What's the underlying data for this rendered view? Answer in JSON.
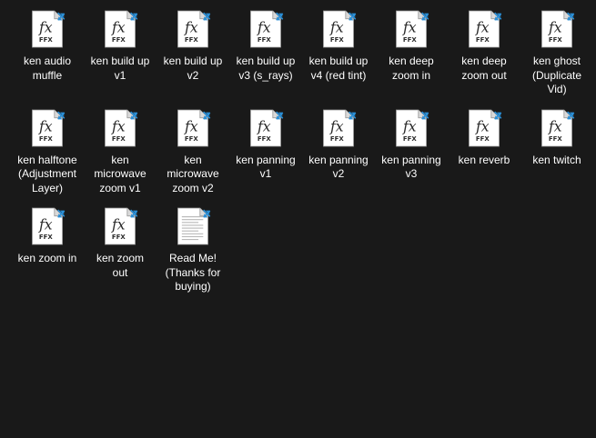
{
  "colors": {
    "background": "#191919",
    "label_text": "#ffffff",
    "page_fill": "#ffffff",
    "page_fold": "#d9d9d9",
    "page_outline": "#9a9a9a",
    "arrow_blue": "#2b8fd6",
    "fx_text": "#2a2a2a"
  },
  "icon_text": {
    "fx": "fx",
    "ffx": "FFX"
  },
  "files": [
    {
      "label": "ken audio muffle",
      "icon": "ffx-file-icon"
    },
    {
      "label": "ken build up v1",
      "icon": "ffx-file-icon"
    },
    {
      "label": "ken build up v2",
      "icon": "ffx-file-icon"
    },
    {
      "label": "ken build up v3 (s_rays)",
      "icon": "ffx-file-icon"
    },
    {
      "label": "ken build up v4 (red tint)",
      "icon": "ffx-file-icon"
    },
    {
      "label": "ken deep zoom in",
      "icon": "ffx-file-icon"
    },
    {
      "label": "ken deep zoom out",
      "icon": "ffx-file-icon"
    },
    {
      "label": "ken ghost (Duplicate Vid)",
      "icon": "ffx-file-icon"
    },
    {
      "label": "ken halftone (Adjustment Layer)",
      "icon": "ffx-file-icon"
    },
    {
      "label": "ken microwave zoom v1",
      "icon": "ffx-file-icon"
    },
    {
      "label": "ken microwave zoom v2",
      "icon": "ffx-file-icon"
    },
    {
      "label": "ken panning v1",
      "icon": "ffx-file-icon"
    },
    {
      "label": "ken panning v2",
      "icon": "ffx-file-icon"
    },
    {
      "label": "ken panning v3",
      "icon": "ffx-file-icon"
    },
    {
      "label": "ken reverb",
      "icon": "ffx-file-icon"
    },
    {
      "label": "ken twitch",
      "icon": "ffx-file-icon"
    },
    {
      "label": "ken zoom in",
      "icon": "ffx-file-icon"
    },
    {
      "label": "ken zoom out",
      "icon": "ffx-file-icon"
    },
    {
      "label": "Read Me! (Thanks for buying)",
      "icon": "text-file-icon"
    }
  ]
}
